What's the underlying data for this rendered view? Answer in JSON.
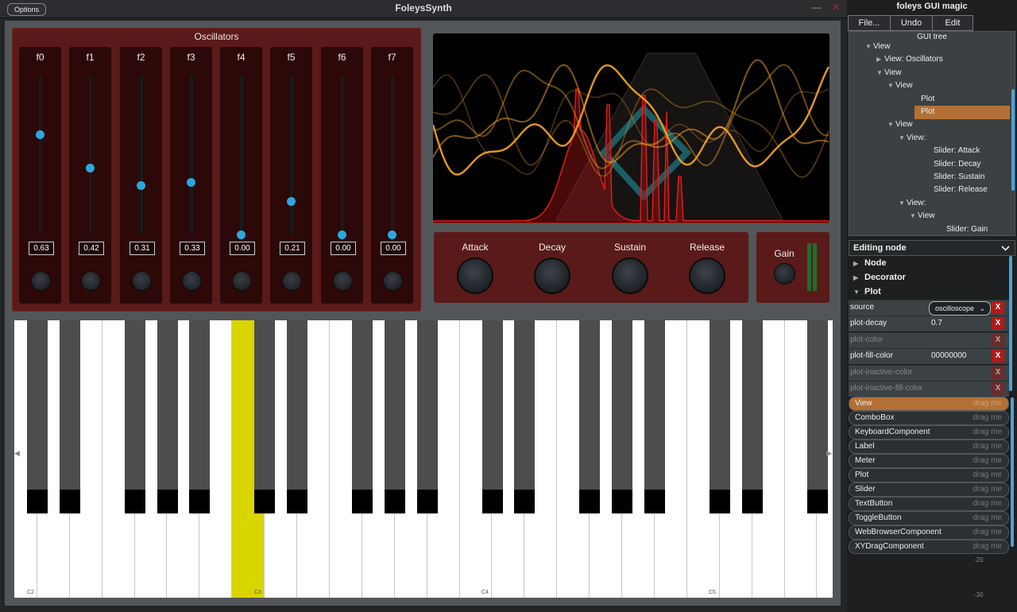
{
  "window": {
    "options_label": "Options",
    "title": "FoleysSynth",
    "minimize_glyph": "—",
    "close_glyph": "✕"
  },
  "oscillators": {
    "title": "Oscillators",
    "columns": [
      {
        "label": "f0",
        "value": "0.63",
        "level": 0.63
      },
      {
        "label": "f1",
        "value": "0.42",
        "level": 0.42
      },
      {
        "label": "f2",
        "value": "0.31",
        "level": 0.31
      },
      {
        "label": "f3",
        "value": "0.33",
        "level": 0.33
      },
      {
        "label": "f4",
        "value": "0.00",
        "level": 0.0
      },
      {
        "label": "f5",
        "value": "0.21",
        "level": 0.21
      },
      {
        "label": "f6",
        "value": "0.00",
        "level": 0.0
      },
      {
        "label": "f7",
        "value": "0.00",
        "level": 0.0
      }
    ]
  },
  "envelope": {
    "knobs": [
      "Attack",
      "Decay",
      "Sustain",
      "Release"
    ]
  },
  "gain": {
    "label": "Gain"
  },
  "keyboard": {
    "octave_labels": [
      "C2",
      "C3",
      "C4",
      "C5"
    ],
    "highlight_key": "C3",
    "highlight_color": "#d9d500",
    "scroll_left_glyph": "◀",
    "scroll_right_glyph": "▶"
  },
  "editor": {
    "title": "foleys GUI magic",
    "menu": [
      "File...",
      "Undo",
      "Edit"
    ],
    "tree_title": "GUI tree",
    "tree": [
      {
        "label": "View",
        "arrow": "▼"
      },
      {
        "label": "View: Oscillators",
        "arrow": "▶"
      },
      {
        "label": "View",
        "arrow": "▼"
      },
      {
        "label": "View",
        "arrow": "▼"
      },
      {
        "label": "Plot",
        "arrow": ""
      },
      {
        "label": "Plot",
        "arrow": ""
      },
      {
        "label": "View",
        "arrow": "▼"
      },
      {
        "label": "View:",
        "arrow": "▼"
      },
      {
        "label": "Slider: Attack",
        "arrow": ""
      },
      {
        "label": "Slider: Decay",
        "arrow": ""
      },
      {
        "label": "Slider: Sustain",
        "arrow": ""
      },
      {
        "label": "Slider: Release",
        "arrow": ""
      },
      {
        "label": "View:",
        "arrow": "▼"
      },
      {
        "label": "View",
        "arrow": "▼"
      },
      {
        "label": "Slider: Gain",
        "arrow": ""
      }
    ],
    "editing_title": "Editing node",
    "sections": [
      {
        "label": "Node",
        "arrow": "▶"
      },
      {
        "label": "Decorator",
        "arrow": "▶"
      },
      {
        "label": "Plot",
        "arrow": "▼"
      }
    ],
    "properties": [
      {
        "name": "source",
        "value": "oscilloscope",
        "remove": "X"
      },
      {
        "name": "plot-decay",
        "value": "0.7",
        "remove": "X"
      },
      {
        "name": "plot-color",
        "value": "",
        "remove": "X"
      },
      {
        "name": "plot-fill-color",
        "value": "00000000",
        "remove": "X"
      },
      {
        "name": "plot-inactive-color",
        "value": "",
        "remove": "X"
      },
      {
        "name": "plot-inactive-fill-color",
        "value": "",
        "remove": "X"
      }
    ],
    "palette_drag_label": "drag me",
    "palette": [
      "View",
      "ComboBox",
      "KeyboardComponent",
      "Label",
      "Meter",
      "Plot",
      "Slider",
      "TextButton",
      "ToggleButton",
      "WebBrowserComponent",
      "XYDragComponent"
    ],
    "meter_scale": [
      "-20",
      "-30"
    ]
  },
  "colors": {
    "panel": "#5a1a1a",
    "accent_blue": "#2ba8e0",
    "selection_orange": "#b27036",
    "plot_orange": "#f0a020",
    "plot_red": "#d01818"
  }
}
